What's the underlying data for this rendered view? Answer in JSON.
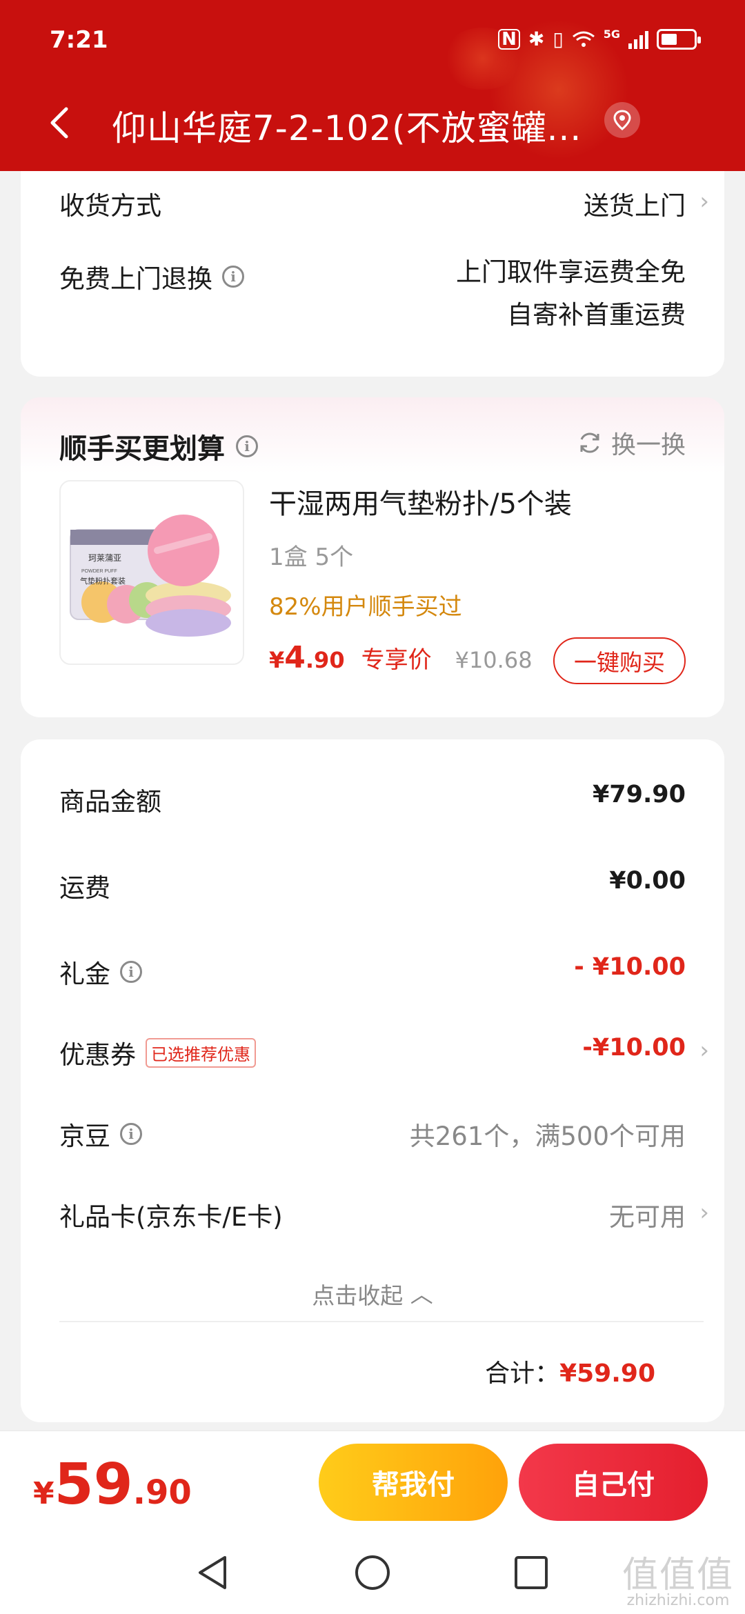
{
  "status_bar": {
    "time": "7:21",
    "network": "5G"
  },
  "header": {
    "address": "仰山华庭7-2-102(不放蜜罐..."
  },
  "delivery": {
    "method_label": "收货方式",
    "method_value": "送货上门",
    "return_label": "免费上门退换",
    "return_line1": "上门取件享运费全免",
    "return_line2": "自寄补首重运费"
  },
  "addon": {
    "title": "顺手买更划算",
    "swap_label": "换一换",
    "product": {
      "name": "干湿两用气垫粉扑/5个装",
      "spec": "1盒 5个",
      "popularity": "82%用户顺手买过",
      "price_symbol": "¥",
      "price_int": "4",
      "price_dec": ".90",
      "price_tag": "专享价",
      "original_price": "¥10.68",
      "buy_label": "一键购买",
      "image_text_brand": "珂莱蒲亚",
      "image_text_en": "POWDER PUFF",
      "image_text_cn": "气垫粉扑套装"
    }
  },
  "summary": {
    "goods_label": "商品金额",
    "goods_value": "¥79.90",
    "shipping_label": "运费",
    "shipping_value": "¥0.00",
    "gift_label": "礼金",
    "gift_value": "- ¥10.00",
    "coupon_label": "优惠券",
    "coupon_badge": "已选推荐优惠",
    "coupon_value": "-¥10.00",
    "beans_label": "京豆",
    "beans_value": "共261个，满500个可用",
    "card_label": "礼品卡(京东卡/E卡)",
    "card_value": "无可用",
    "collapse_label": "点击收起",
    "total_label": "合计：",
    "total_value": "¥59.90"
  },
  "bottom_bar": {
    "price_symbol": "¥",
    "price_int": "59",
    "price_dec": ".90",
    "help_pay_label": "帮我付",
    "self_pay_label": "自己付"
  },
  "watermark": {
    "main": "值值值",
    "sub": "zhizhizhi.com"
  },
  "colors": {
    "header_red": "#c8100e",
    "accent_red": "#e0261a",
    "orange_text": "#d4880e",
    "help_btn": "#ffb612",
    "self_btn": "#eb2a3c"
  }
}
